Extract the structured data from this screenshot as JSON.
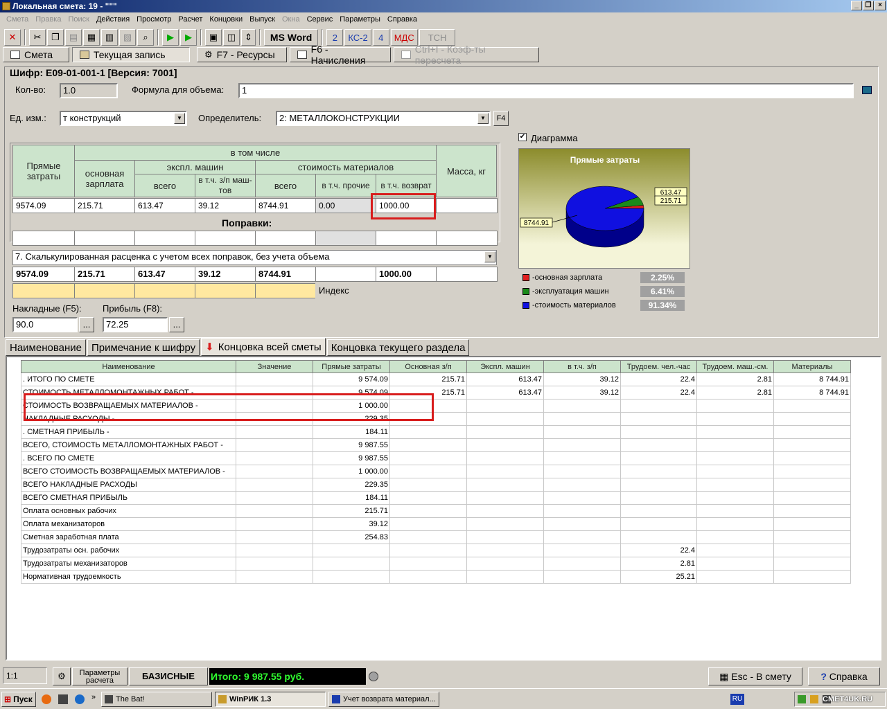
{
  "window": {
    "title": "Локальная смета: 19 - \"\"\""
  },
  "menu": [
    {
      "label": "Смета",
      "disabled": true
    },
    {
      "label": "Правка",
      "disabled": true
    },
    {
      "label": "Поиск",
      "disabled": true
    },
    {
      "label": "Действия",
      "disabled": false
    },
    {
      "label": "Просмотр",
      "disabled": false
    },
    {
      "label": "Расчет",
      "disabled": false
    },
    {
      "label": "Концовки",
      "disabled": false
    },
    {
      "label": "Выпуск",
      "disabled": false
    },
    {
      "label": "Окна",
      "disabled": true
    },
    {
      "label": "Сервис",
      "disabled": false
    },
    {
      "label": "Параметры",
      "disabled": false
    },
    {
      "label": "Справка",
      "disabled": false
    }
  ],
  "toolbar": {
    "ms_word": "MS Word",
    "b2": "2",
    "ks2": "КС-2",
    "b4": "4",
    "mds": "МДС",
    "tsn": "ТСН"
  },
  "top_tabs": [
    {
      "label": "Смета"
    },
    {
      "label": "Текущая запись"
    },
    {
      "label": "F7 - Ресурсы"
    },
    {
      "label": "F6 - Начисления"
    },
    {
      "label": "Ctrl+I - Коэф-ты пересчета"
    }
  ],
  "record": {
    "cipher": "Шифр: Е09-01-001-1  [Версия: 7001]",
    "qty_label": "Кол-во:",
    "qty_value": "1.0",
    "formula_label": "Формула для объема:",
    "formula_value": "1",
    "unit_label": "Ед. изм.:",
    "unit_value": "т конструкций",
    "determinant_label": "Определитель:",
    "determinant_value": "2: МЕТАЛЛОКОНСТРУКЦИИ",
    "f4": "F4",
    "diagram_label": "Диаграмма"
  },
  "cost_table": {
    "h_direct": "Прямые затраты",
    "h_including": "в том числе",
    "h_mass": "Масса, кг",
    "h_salary": "основная зарплата",
    "h_machines": "экспл. машин",
    "h_materials": "стоимость материалов",
    "h_mach_total": "всего",
    "h_mach_salary": "в т.ч. з/п маш-тов",
    "h_mat_total": "всего",
    "h_mat_other": "в т.ч. прочие",
    "h_mat_return": "в т.ч. возврат",
    "row": [
      "9574.09",
      "215.71",
      "613.47",
      "39.12",
      "8744.91",
      "0.00",
      "1000.00",
      ""
    ],
    "corrections": "Поправки:",
    "calc_mode": "7. Скалькулированная расценка с учетом всех поправок, без учета объема",
    "total_row": [
      "9574.09",
      "215.71",
      "613.47",
      "39.12",
      "8744.91",
      "",
      "1000.00",
      ""
    ],
    "index_label": "Индекс"
  },
  "overhead": {
    "label": "Накладные (F5):",
    "value": "90.0",
    "dots": "..."
  },
  "profit": {
    "label": "Прибыль (F8):",
    "value": "72.25",
    "dots": "..."
  },
  "chart_data": {
    "type": "pie",
    "title": "Прямые затраты",
    "labels": [
      "основная зарплата",
      "эксплуатация машин",
      "стоимость материалов"
    ],
    "values": [
      215.71,
      613.47,
      8744.91
    ],
    "percent_labels": [
      "2.25%",
      "6.41%",
      "91.34%"
    ],
    "colors": [
      "#e02020",
      "#1a8a1a",
      "#1010e0"
    ]
  },
  "bottom_tabs": [
    {
      "label": "Наименование"
    },
    {
      "label": "Примечание к шифру"
    },
    {
      "label": "Концовка всей сметы"
    },
    {
      "label": "Концовка текущего раздела"
    }
  ],
  "grid": {
    "columns": [
      "Наименование",
      "Значение",
      "Прямые затраты",
      "Основная з/п",
      "Экспл. машин",
      "в т.ч. з/п",
      "Трудоем. чел.-час",
      "Трудоем. маш.-см.",
      "Материалы"
    ],
    "rows": [
      [
        ".  ИТОГО  ПО  СМЕТЕ",
        "",
        "9 574.09",
        "215.71",
        "613.47",
        "39.12",
        "22.4",
        "2.81",
        "8 744.91"
      ],
      [
        "СТОИМОСТЬ МЕТАЛЛОМОНТАЖНЫХ РАБОТ -",
        "",
        "9 574.09",
        "215.71",
        "613.47",
        "39.12",
        "22.4",
        "2.81",
        "8 744.91"
      ],
      [
        "   СТОИМОСТЬ ВОЗВРАЩАЕМЫХ МАТЕРИАЛОВ -",
        "",
        "1 000.00",
        "",
        "",
        "",
        "",
        "",
        ""
      ],
      [
        "   НАКЛАДНЫЕ РАСХОДЫ -",
        "",
        "229.35",
        "",
        "",
        "",
        "",
        "",
        ""
      ],
      [
        ".   СМЕТНАЯ ПРИБЫЛЬ -",
        "",
        "184.11",
        "",
        "",
        "",
        "",
        "",
        ""
      ],
      [
        "ВСЕГО, СТОИМОСТЬ МЕТАЛЛОМОНТАЖНЫХ РАБОТ -",
        "",
        "9 987.55",
        "",
        "",
        "",
        "",
        "",
        ""
      ],
      [
        ". ВСЕГО  ПО  СМЕТЕ",
        "",
        "9 987.55",
        "",
        "",
        "",
        "",
        "",
        ""
      ],
      [
        "ВСЕГО СТОИМОСТЬ ВОЗВРАЩАЕМЫХ МАТЕРИАЛОВ -",
        "",
        "1 000.00",
        "",
        "",
        "",
        "",
        "",
        ""
      ],
      [
        "ВСЕГО НАКЛАДНЫЕ РАСХОДЫ",
        "",
        "229.35",
        "",
        "",
        "",
        "",
        "",
        ""
      ],
      [
        "ВСЕГО СМЕТНАЯ ПРИБЫЛЬ",
        "",
        "184.11",
        "",
        "",
        "",
        "",
        "",
        ""
      ],
      [
        "Оплата основных рабочих",
        "",
        "215.71",
        "",
        "",
        "",
        "",
        "",
        ""
      ],
      [
        "Оплата механизаторов",
        "",
        "39.12",
        "",
        "",
        "",
        "",
        "",
        ""
      ],
      [
        "Сметная заработная плата",
        "",
        "254.83",
        "",
        "",
        "",
        "",
        "",
        ""
      ],
      [
        "Трудозатраты осн. рабочих",
        "",
        "",
        "",
        "",
        "",
        "22.4",
        "",
        ""
      ],
      [
        "Трудозатраты механизаторов",
        "",
        "",
        "",
        "",
        "",
        "2.81",
        "",
        ""
      ],
      [
        "Нормативная трудоемкость",
        "",
        "",
        "",
        "",
        "",
        "25.21",
        "",
        ""
      ]
    ]
  },
  "status": {
    "pos": "1:1",
    "params": "Параметры расчета",
    "mode": "БАЗИСНЫЕ",
    "total": "Итого: 9 987.55 руб.",
    "esc": "Esc - В смету",
    "help": "Справка"
  },
  "taskbar": {
    "start": "Пуск",
    "thebat": "The Bat!",
    "winrik": "WinPИК 1.3",
    "doc": "Учет возврата материал...",
    "lang": "RU",
    "watermark": "CMET4UK.RU"
  }
}
